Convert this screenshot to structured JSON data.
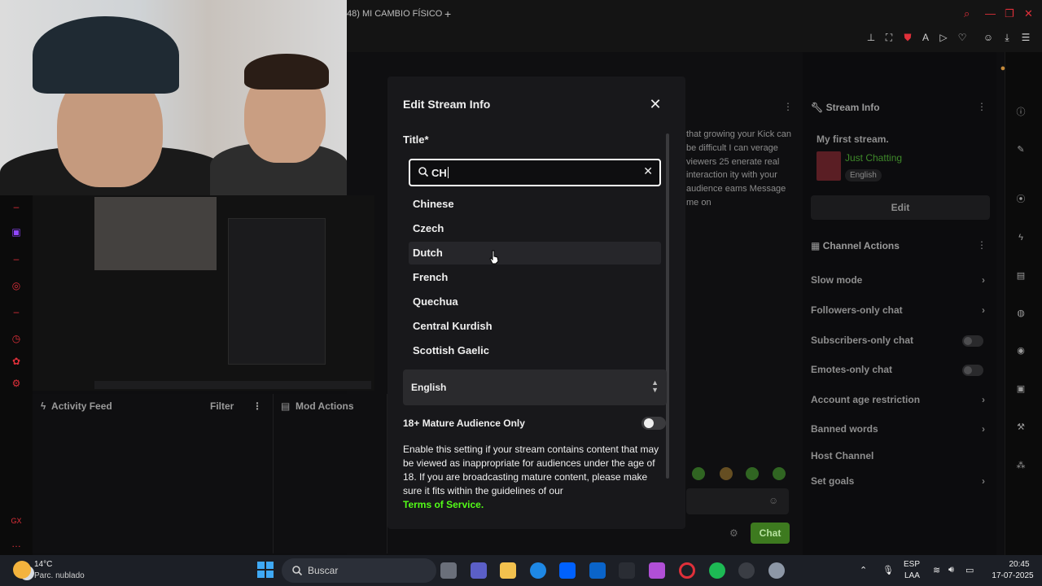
{
  "browser": {
    "tab_title": "48) MI CAMBIO FÍSICO",
    "new_tab": "+",
    "search_glyph": "⌕",
    "minimize": "—",
    "restore": "❐",
    "close": "✕"
  },
  "dashboard": {
    "activity_feed": "Activity Feed",
    "filter": "Filter",
    "mod_actions": "Mod Actions",
    "chat_preview": "that growing your Kick can be difficult I can verage viewers 25 enerate real interaction ity with your audience eams Message me on",
    "chat_button": "Chat",
    "stream_info": {
      "header": "Stream Info",
      "title": "My first stream.",
      "category": "Just Chatting",
      "language": "English",
      "edit": "Edit"
    },
    "channel_actions": {
      "header": "Channel Actions",
      "items": [
        {
          "label": "Slow mode",
          "control": "chevron"
        },
        {
          "label": "Followers-only chat",
          "control": "chevron"
        },
        {
          "label": "Subscribers-only chat",
          "control": "toggle"
        },
        {
          "label": "Emotes-only chat",
          "control": "toggle"
        },
        {
          "label": "Account age restriction",
          "control": "chevron"
        },
        {
          "label": "Banned words",
          "control": "chevron"
        },
        {
          "label": "Host Channel",
          "control": "none"
        },
        {
          "label": "Set goals",
          "control": "chevron"
        }
      ]
    }
  },
  "modal": {
    "title": "Edit Stream Info",
    "close": "✕",
    "title_label": "Title*",
    "search_value": "CH",
    "search_clear": "✕",
    "options": [
      "Chinese",
      "Czech",
      "Dutch",
      "French",
      "Quechua",
      "Central Kurdish",
      "Scottish Gaelic"
    ],
    "hovered_option": "Dutch",
    "language_selected": "English",
    "mature_label": "18+ Mature Audience Only",
    "mature_enabled": false,
    "mature_desc": "Enable this setting if your stream contains content that may be viewed as inappropriate for audiences under the age of 18. If you are broadcasting mature content, please make sure it fits within the guidelines of our",
    "tos_link": "Terms of Service."
  },
  "taskbar": {
    "temperature": "14°C",
    "weather": "Parc. nublado",
    "search_placeholder": "Buscar",
    "lang_top": "ESP",
    "lang_bottom": "LAA",
    "time": "20:45",
    "date": "17-07-2025"
  },
  "colors": {
    "accent_green": "#53fc18",
    "browser_red": "#e0303a",
    "modal_bg": "#18181b"
  }
}
